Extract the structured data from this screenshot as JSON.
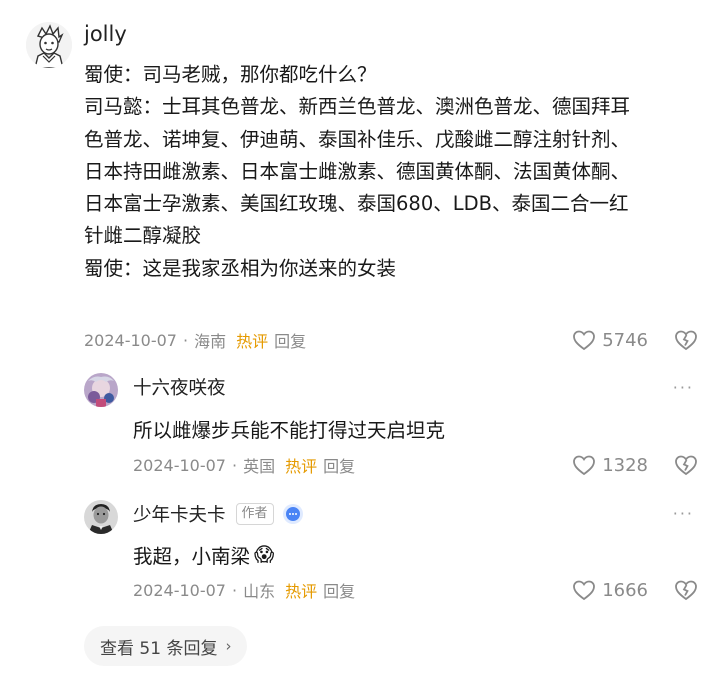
{
  "main_comment": {
    "username": "jolly",
    "lines": [
      "蜀使：司马老贼，那你都吃什么？",
      "司马懿：士耳其色普龙、新西兰色普龙、澳洲色普龙、德国拜耳",
      "色普龙、诺坤复、伊迪萌、泰国补佳乐、戊酸雌二醇注射针剂、",
      "日本持田雌激素、日本富士雌激素、德国黄体酮、法国黄体酮、",
      "日本富士孕激素、美国红玫瑰、泰国680、LDB、泰国二合一红",
      "针雌二醇凝胶",
      "蜀使：这是我家丞相为你送来的女装"
    ],
    "date": "2024-10-07",
    "separator": "·",
    "location": "海南",
    "hot_label": "热评",
    "reply_label": "回复",
    "likes": "5746"
  },
  "replies": [
    {
      "username": "十六夜咲夜",
      "text": "所以雌爆步兵能不能打得过天启坦克",
      "date": "2024-10-07",
      "separator": "·",
      "location": "英国",
      "hot_label": "热评",
      "reply_label": "回复",
      "likes": "1328",
      "more": "···"
    },
    {
      "username": "少年卡夫卡",
      "author_tag": "作者",
      "text": "我超，小南梁",
      "emoji": "😱",
      "date": "2024-10-07",
      "separator": "·",
      "location": "山东",
      "hot_label": "热评",
      "reply_label": "回复",
      "likes": "1666",
      "more": "···"
    }
  ],
  "view_replies": {
    "label": "查看 51 条回复",
    "chevron": "›"
  },
  "colors": {
    "hot": "#e59a00",
    "meta": "#8a8a8a",
    "text": "#191919"
  }
}
